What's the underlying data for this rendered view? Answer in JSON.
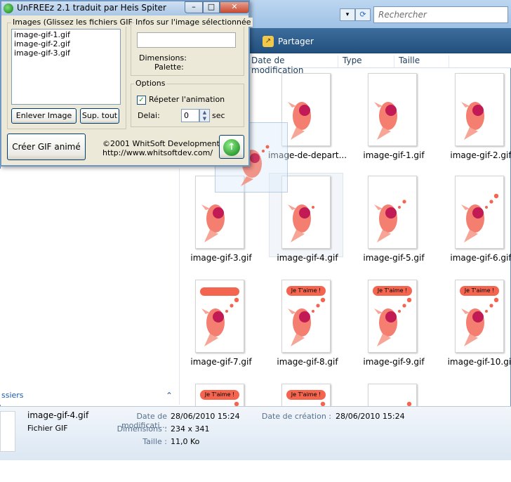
{
  "explorer": {
    "search_placeholder": "Rechercher",
    "share_label": "Partager",
    "columns": [
      "Date de modification",
      "Type",
      "Taille"
    ],
    "left_pane_label": "ssiers",
    "files": [
      {
        "name": "image-de-depart..."
      },
      {
        "name": "image-gif-1.gif"
      },
      {
        "name": "image-gif-2.gif"
      },
      {
        "name": "image-gif-3.gif"
      },
      {
        "name": "image-gif-4.gif"
      },
      {
        "name": "image-gif-5.gif"
      },
      {
        "name": "image-gif-6.gif"
      },
      {
        "name": "image-gif-7.gif"
      },
      {
        "name": "image-gif-8.gif",
        "badge": "Je T'aime !"
      },
      {
        "name": "image-gif-9.gif",
        "badge": "Je T'aime !"
      },
      {
        "name": "image-gif-10.gif",
        "badge": "Je T'aime !"
      },
      {
        "name": "",
        "badge": "Je T'aime !"
      },
      {
        "name": "",
        "badge": "Je T'aime !"
      },
      {
        "name": ""
      }
    ],
    "details": {
      "filename": "image-gif-4.gif",
      "filetype": "Fichier GIF",
      "modified_label": "Date de modificati...",
      "modified_value": "28/06/2010 15:24",
      "created_label": "Date de création :",
      "created_value": "28/06/2010 15:24",
      "dimensions_label": "Dimensions :",
      "dimensions_value": "234 x 341",
      "size_label": "Taille :",
      "size_value": "11,0 Ko"
    }
  },
  "unfreez": {
    "title": "UnFREEz 2.1 traduit par Heis Spiter",
    "images_group": "Images (Glissez les fichiers GIF ici)",
    "images": [
      "image-gif-1.gif",
      "image-gif-2.gif",
      "image-gif-3.gif"
    ],
    "remove_button": "Enlever Image",
    "clear_button": "Sup. tout",
    "info_group": "Infos sur l'image sélectionnée",
    "dimensions_label": "Dimensions:",
    "palette_label": "Palette:",
    "options_group": "Options",
    "repeat_label": "Répeter l'animation",
    "repeat_checked": true,
    "delay_label": "Delai:",
    "delay_value": "0",
    "delay_unit": "sec",
    "create_button": "Créer GIF animé",
    "copyright": "©2001 WhitSoft Development",
    "website": "http://www.whitsoftdev.com/"
  }
}
